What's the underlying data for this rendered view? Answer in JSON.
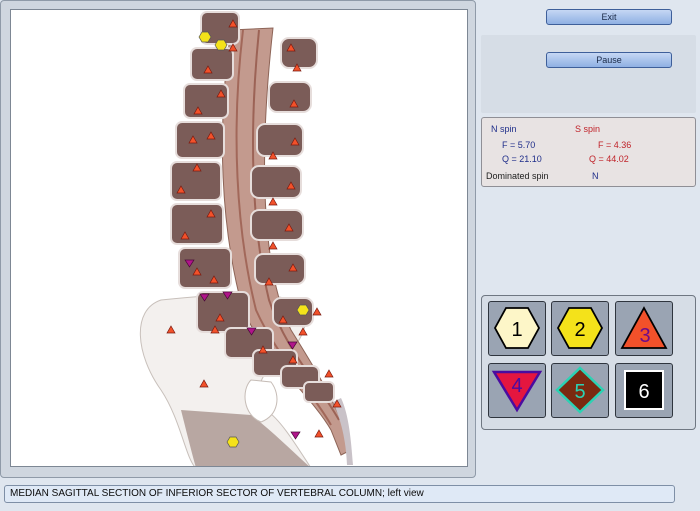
{
  "buttons": {
    "exit_label": "Exit",
    "pause_label": "Pause"
  },
  "spin": {
    "n_title": "N spin",
    "s_title": "S spin",
    "n_f": "F =  5.70",
    "n_q": "Q = 21.10",
    "s_f": "F =  4.36",
    "s_q": "Q = 44.02",
    "dominated_label": "Dominated spin",
    "dominated_value": "N"
  },
  "shapes": [
    {
      "label": "1",
      "icon": "hexagon-icon",
      "fill": "#fdf6c8"
    },
    {
      "label": "2",
      "icon": "hexagon-icon",
      "fill": "#f4e21a"
    },
    {
      "label": "3",
      "icon": "triangle-up-icon",
      "fill": "#f2512a"
    },
    {
      "label": "4",
      "icon": "triangle-down-icon",
      "fill": "#e4163f"
    },
    {
      "label": "5",
      "icon": "diamond-icon",
      "fill": "#7a2a10"
    },
    {
      "label": "6",
      "icon": "square-icon",
      "fill": "#000000"
    }
  ],
  "status_text": "MEDIAN SAGITTAL SECTION OF INFERIOR SECTOR OF VERTEBRAL COLUMN; left view",
  "colors": {
    "marker_triangle_up": "#f2512a",
    "marker_triangle_down": "#b0148a",
    "marker_hexagon": "#f4e21a",
    "bone": "#7b5c58",
    "canal": "#c39a8e"
  }
}
